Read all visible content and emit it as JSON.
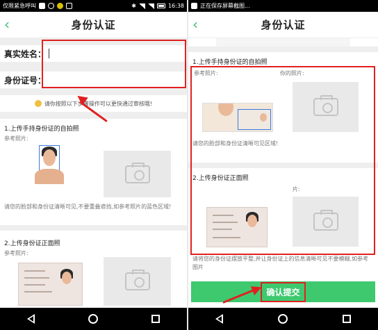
{
  "left": {
    "statusbar": {
      "carrier": "仅限紧急呼叫",
      "time": "16:38"
    },
    "title": "身份认证",
    "fields": {
      "name_label": "真实姓名：",
      "id_label": "身份证号："
    },
    "tip": "请你按照以下步骤操作可以更快通过审核哦!",
    "section1": {
      "heading": "1.上传手持身份证的自拍照",
      "ref": "参考照片:",
      "note": "请您的脸部和身份证清晰可见,不要重叠遮挡,如参考照片的蓝色区域!"
    },
    "section2": {
      "heading": "2.上传身份证正面照",
      "ref": "参考照片:"
    }
  },
  "right": {
    "statusbar": {
      "notice": "正在保存屏幕截图..."
    },
    "title": "身份认证",
    "section1": {
      "heading": "1.上传手持身份证的自拍照",
      "ref": "参考照片:",
      "yours": "你的照片:",
      "note": "请您的脸部和身份证清晰可见区域!"
    },
    "section2": {
      "heading": "2.上传身份证正面照",
      "yours": "片:",
      "note": "请将您的身份证摆放平整,并让身份证上的信息清晰可见不要模糊,如参考图片"
    },
    "confirm_label": "确认提交"
  },
  "colors": {
    "accent": "#3ec96f",
    "highlight": "#e02020"
  }
}
